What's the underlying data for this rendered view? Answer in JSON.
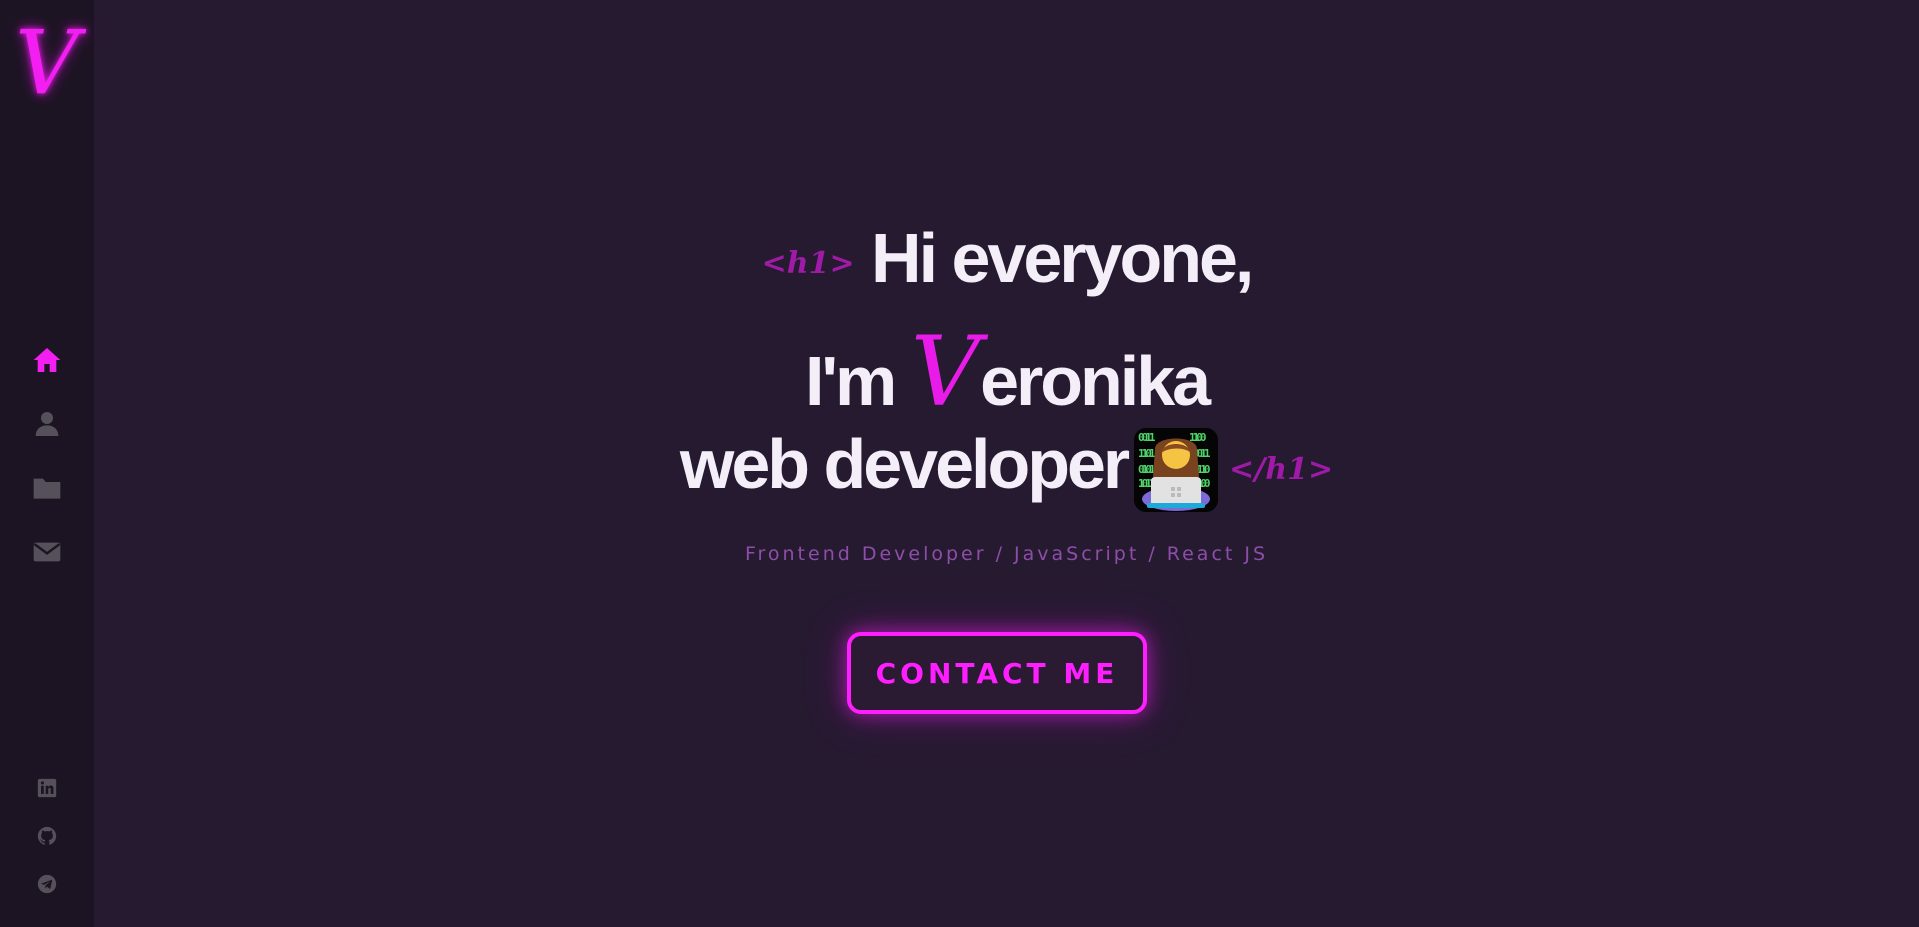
{
  "brand": {
    "logo_letter": "V",
    "accent_color": "#f21ef2"
  },
  "sidebar": {
    "nav": [
      {
        "name": "home",
        "icon": "home-icon",
        "active": true
      },
      {
        "name": "about",
        "icon": "user-icon",
        "active": false
      },
      {
        "name": "portfolio",
        "icon": "folder-icon",
        "active": false
      },
      {
        "name": "contact",
        "icon": "envelope-icon",
        "active": false
      }
    ],
    "socials": [
      {
        "name": "linkedin",
        "icon": "linkedin-icon"
      },
      {
        "name": "github",
        "icon": "github-icon"
      },
      {
        "name": "telegram",
        "icon": "telegram-icon"
      }
    ]
  },
  "hero": {
    "tag_open": "<h1>",
    "line1": "Hi everyone,",
    "line2_prefix": "I'm ",
    "name_initial": "V",
    "name_rest": "eronika",
    "line3": "web developer",
    "emoji": "woman-technologist-icon",
    "tag_close": "</h1>",
    "subtitle": "Frontend Developer / JavaScript / React JS",
    "cta_label": "CONTACT ME"
  }
}
